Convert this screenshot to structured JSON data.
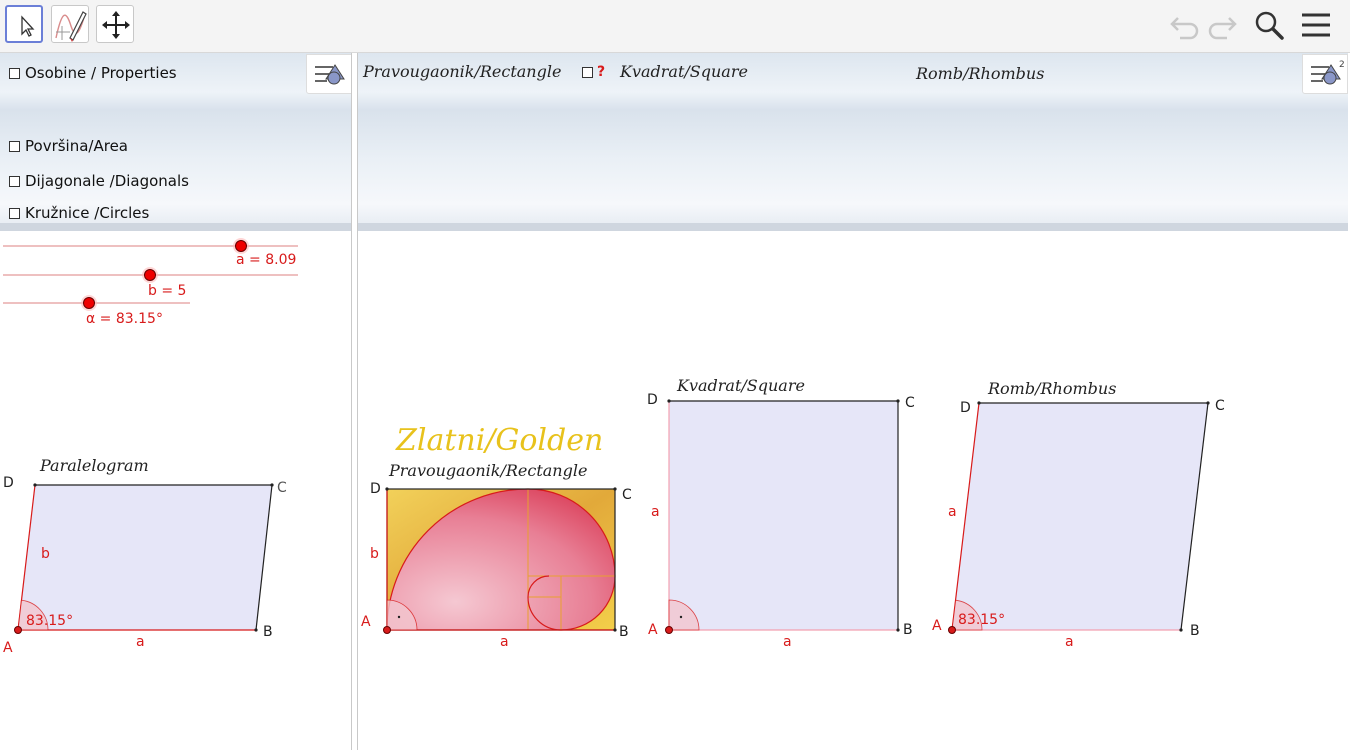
{
  "toolbar": {
    "tools": [
      "move-tool",
      "function-inspector-tool",
      "move-graphics-view-tool"
    ],
    "right": [
      "undo-icon",
      "redo-icon",
      "search-icon",
      "menu-icon"
    ]
  },
  "left_panel": {
    "checkboxes": [
      {
        "label": "Osobine / Properties",
        "checked": false
      },
      {
        "label": "Površina/Area",
        "checked": false
      },
      {
        "label": "Dijagonale /Diagonals",
        "checked": false
      },
      {
        "label": "Kružnice /Circles",
        "checked": false
      }
    ],
    "sliders": [
      {
        "label": "a = 8.09",
        "value": 8.09
      },
      {
        "label": "b = 5",
        "value": 5
      },
      {
        "label": "α = 83.15°",
        "value": 83.15
      }
    ]
  },
  "right_panel": {
    "header_rectangle": "Pravougaonik/Rectangle",
    "header_question": "?",
    "header_square": "Kvadrat/Square",
    "header_rhombus": "Romb/Rhombus"
  },
  "figures": {
    "parallelogram": {
      "title": "Paralelogram",
      "angle": "83.15°",
      "side_a": "a",
      "side_b": "b",
      "vertices": [
        "A",
        "B",
        "C",
        "D"
      ]
    },
    "golden": {
      "title_big": "Zlatni/Golden",
      "title": "Pravougaonik/Rectangle",
      "side_a": "a",
      "side_b": "b",
      "vertices": [
        "A",
        "B",
        "C",
        "D"
      ]
    },
    "square": {
      "title": "Kvadrat/Square",
      "side_a_bottom": "a",
      "side_a_left": "a",
      "vertices": [
        "A",
        "B",
        "C",
        "D"
      ]
    },
    "rhombus": {
      "title": "Romb/Rhombus",
      "angle": "83.15°",
      "side_a_bottom": "a",
      "side_a_left": "a",
      "vertices": [
        "A",
        "B",
        "C",
        "D"
      ]
    }
  },
  "colors": {
    "accent": "#d81b1b",
    "fill": "#e3e3f7",
    "golden": "#e8c21c"
  }
}
